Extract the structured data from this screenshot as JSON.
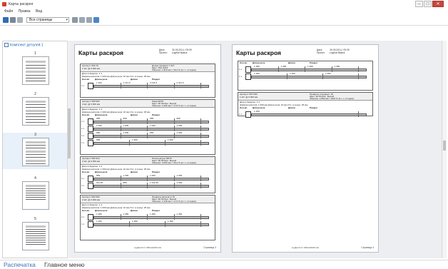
{
  "window": {
    "title": "Карты раскроя",
    "minimize": "–",
    "maximize": "□",
    "close": "✕"
  },
  "menu": [
    "Файл",
    "Правка",
    "Вид"
  ],
  "toolbar": {
    "icons": [
      "save-icon",
      "print-icon",
      "print-setup-icon"
    ],
    "page_select_value": "Все страницы",
    "page_select_arrow": "▾",
    "icons_right": [
      "zoom-icon",
      "fit-page-icon",
      "two-pages-icon",
      "view-mode-icon"
    ]
  },
  "sidebar": {
    "header": "Комплект деталей 1",
    "pages": [
      "1",
      "2",
      "3",
      "4",
      "5"
    ],
    "selected": "3"
  },
  "pages": [
    {
      "title": "Карты раскроя",
      "date_label": "Дата:",
      "date": "30.09.2014 / 09:39",
      "project_label": "Проект:",
      "project": "LogiKal Basics",
      "footer_text": "Logikal 9.0 / ORGADATA AG",
      "page_label": "Страница 3",
      "blocks": [
        {
          "header_left": [
            "Артикул: 592-70",
            "1 Шт. @ 6 000 мм"
          ],
          "header_right": [
            "Длина профиля 7 027",
            "Цвет: RAL 9016",
            "Обрезок: 1 819 мм = 30,3 % (в т.ч. отходов)"
          ],
          "scheme": "Дата в Заделке: 1:1",
          "params": "Ширина распила: 1 000 мм   Длина реза: 10 мм   Отх. в конце: 25 мм",
          "cols": [
            "Кол-во",
            "Длина реза",
            "Длина",
            "Раздел"
          ],
          "rows": [
            {
              "qty": "1 x",
              "cuts": [
                "1 400",
                "1 211,5",
                "2 011,5",
                "2 011,5"
              ]
            }
          ]
        },
        {
          "header_left": [
            "Артикул: 590 600",
            "4 Шт. @ 6 000 мм"
          ],
          "header_right": [
            "Рама 68/70",
            "Цвет: 90 PA Бел. Белый",
            "Обрезок: 4 284 мм = 17,8 % (в т.ч. отходов)"
          ],
          "scheme": "Дата в Заделке: 1:1",
          "params": "Ширина распила: 1 000 мм   Длина реза: 10 мм   Отх. в конце: 25 мм",
          "cols": [
            "Кол-во",
            "Длина реза",
            "Длина",
            "Раздел"
          ],
          "rows": [
            {
              "qty": "1 x",
              "cuts": [
                "955",
                "955",
                "955",
                "955"
              ]
            },
            {
              "qty": "1 x",
              "cuts": [
                "1 000",
                "1 000",
                "1 000",
                "1 000"
              ]
            },
            {
              "qty": "1 x",
              "cuts": [
                "890",
                "1 000",
                "650",
                "1 000"
              ]
            },
            {
              "qty": "1 x",
              "cuts": [
                "955",
                "1 600",
                "1 600"
              ]
            }
          ]
        },
        {
          "header_left": [
            "Артикул: 594 010",
            "2 Шт. @ 6 000 мм"
          ],
          "header_right": [
            "Ригельшпрос 68/70",
            "Цвет: 90 PA Бел. Белый",
            "Обрезок: 3 053 мм = 25,4 % (в т.ч. отходов)"
          ],
          "scheme": "Дата в Заделке: 1:1",
          "params": "Ширина распила: 1 000 мм   Длина реза: 10 мм   Отх. в конце: 25 мм",
          "cols": [
            "Кол-во",
            "Длина реза",
            "Длина",
            "Раздел"
          ],
          "rows": [
            {
              "qty": "1 x",
              "cuts": [
                "859",
                "1 000",
                "1 000",
                "1 000"
              ]
            },
            {
              "qty": "1 x",
              "cuts": [
                "611,50",
                "859",
                "1 211,50",
                "1 000"
              ]
            }
          ]
        },
        {
          "header_left": [
            "Артикул: 594 090",
            "2 Шт. @ 6 000 мм"
          ],
          "header_right": [
            "Профиль Штапик в 78",
            "Цвет: 90 PA Бел. Белый",
            "Обрезок: 2 128 мм = 17,9 % (в т.ч. отходов)"
          ],
          "scheme": "Дата в Заделке: 1:1",
          "params": "Ширина распила: 1 000 мм   Длина реза: 10 мм   Отх. в конце: 25 мм",
          "cols": [
            "Кол-во",
            "Длина реза",
            "Длина",
            "Раздел"
          ],
          "rows": [
            {
              "qty": "1 x",
              "cuts": [
                "1 250",
                "1 250",
                "1 250",
                "1 250"
              ]
            },
            {
              "qty": "1 x",
              "cuts": [
                "1 250",
                "1 250",
                "1 250"
              ]
            }
          ]
        }
      ]
    },
    {
      "title": "Карты раскроя",
      "date_label": "Дата:",
      "date": "30.09.2014 / 09:39",
      "project_label": "Проект:",
      "project": "LogiKal Basics",
      "footer_text": "Logikal 9.0 / ORGADATA AG",
      "page_label": "Страница 4",
      "blocks": [
        {
          "header_left": [],
          "header_right": [],
          "scheme": "",
          "params": "",
          "cols": [
            "Кол-во",
            "Длина реза",
            "Длина",
            "Раздел"
          ],
          "rows": [
            {
              "qty": "1 x",
              "cuts": [
                "1 250",
                "1 250",
                "1 250",
                "1 250"
              ]
            },
            {
              "qty": "1 x",
              "cuts": [
                "1 250",
                "1 250",
                "1 250"
              ]
            }
          ]
        },
        {
          "header_left": [
            "Артикул: 597 090",
            "1 Шт. @ 6 000 мм"
          ],
          "header_right": [
            "Профиль Соединит. 10",
            "Цвет: 90 PA Бел. Белый",
            "Обрезок: 4 850 мм = 80,8 % (в т.ч. отходов)"
          ],
          "scheme": "Дата в Заделке: 1:1",
          "params": "Ширина распила: 1 000 мм   Длина реза: 10 мм   Отх. в конце: 25 мм",
          "cols": [
            "Кол-во",
            "Длина реза",
            "Длина",
            "Раздел"
          ],
          "rows": [
            {
              "qty": "1 x",
              "cuts": [
                "1 150"
              ]
            }
          ]
        }
      ]
    }
  ],
  "bottom_tabs": {
    "active": "Распечатка",
    "main": "Главное меню"
  },
  "colors": {
    "accent": "#3a73b7",
    "close": "#c9463d",
    "viewer_bg": "#eceef1"
  }
}
